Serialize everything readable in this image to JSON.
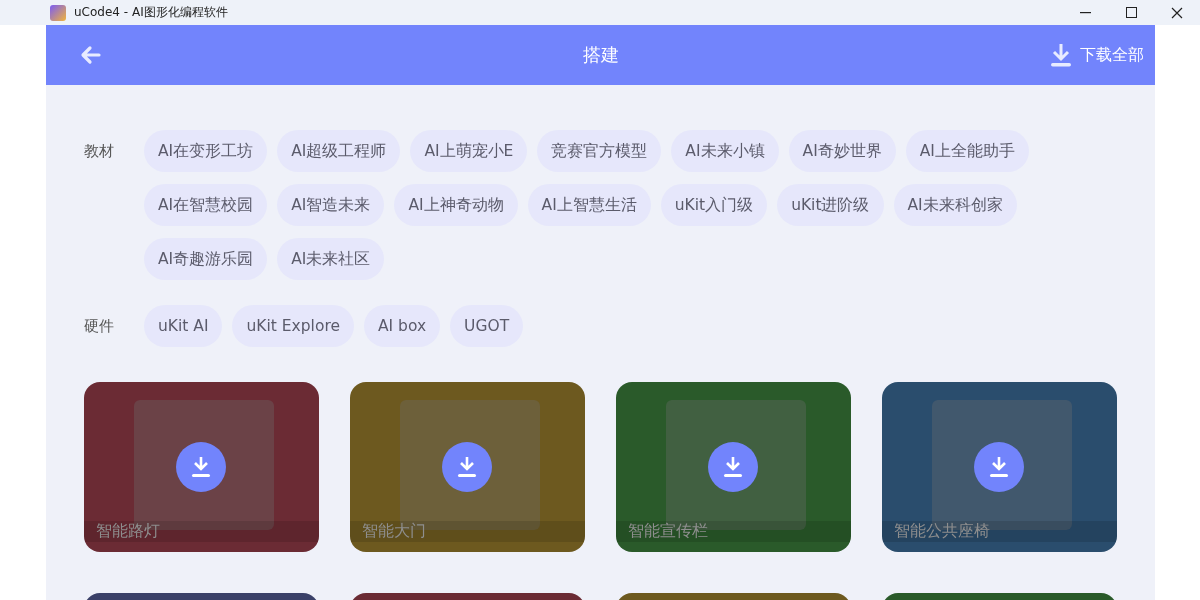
{
  "window": {
    "title": "uCode4 - AI图形化编程软件"
  },
  "header": {
    "title": "搭建",
    "download_all": "下载全部"
  },
  "filters": [
    {
      "label": "教材",
      "tags": [
        "AI在变形工坊",
        "AI超级工程师",
        "AI上萌宠小E",
        "竞赛官方模型",
        "AI未来小镇",
        "AI奇妙世界",
        "AI上全能助手",
        "AI在智慧校园",
        "AI智造未来",
        "AI上神奇动物",
        "AI上智慧生活",
        "uKit入门级",
        "uKit进阶级",
        "AI未来科创家",
        "AI奇趣游乐园",
        "AI未来社区"
      ]
    },
    {
      "label": "硬件",
      "tags": [
        "uKit AI",
        "uKit Explore",
        "AI box",
        "UGOT"
      ]
    }
  ],
  "cards": [
    {
      "title": "智能路灯",
      "color": "#6b2b34"
    },
    {
      "title": "智能大门",
      "color": "#6d591f"
    },
    {
      "title": "智能宣传栏",
      "color": "#2a5a2a"
    },
    {
      "title": "智能公共座椅",
      "color": "#2a4d6d"
    },
    {
      "color": "#3a4068"
    },
    {
      "color": "#6b2b34"
    },
    {
      "color": "#6d591f"
    },
    {
      "color": "#2a5a2a"
    }
  ]
}
